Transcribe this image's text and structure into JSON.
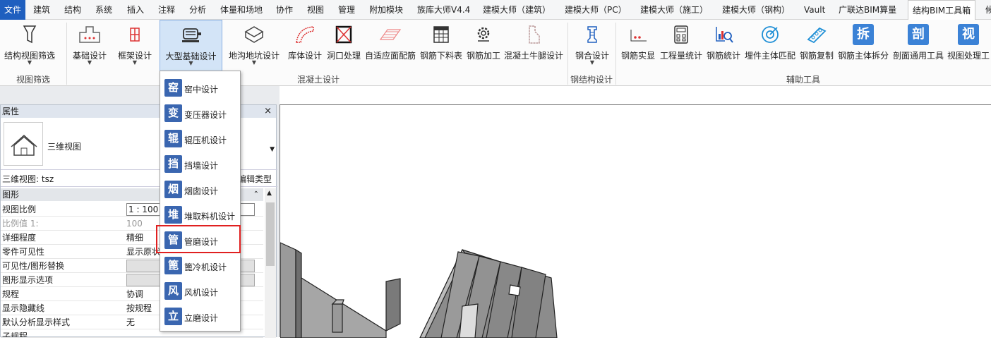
{
  "menu_tabs": [
    "文件",
    "建筑",
    "结构",
    "系统",
    "插入",
    "注释",
    "分析",
    "体量和场地",
    "协作",
    "视图",
    "管理",
    "附加模块",
    "族库大师V4.4",
    "建模大师（建筑）",
    "建模大师（PC）",
    "建模大师（施工）",
    "建模大师（钢构）",
    "Vault",
    "广联达BIM算量",
    "结构BIM工具箱",
    "候"
  ],
  "active_tab": "结构BIM工具箱",
  "ribbon": {
    "buttons": [
      "结构视图筛选",
      "基础设计",
      "框架设计",
      "大型基础设计",
      "地沟地坑设计",
      "库体设计",
      "洞口处理",
      "自适应面配筋",
      "钢筋下料表",
      "钢筋加工",
      "混凝土牛腿设计",
      "钢合设计",
      "钢筋实显",
      "工程量统计",
      "钢筋統计",
      "埋件主体匹配",
      "钢筋复制",
      "钢筋主体拆分",
      "剖面通用工具",
      "视图处理工"
    ],
    "glyph_buttons": {
      "split": "拆",
      "section": "剖",
      "view": "视"
    },
    "groups": [
      "视图筛选",
      "混凝土设计",
      "钢结构设计",
      "辅助工具"
    ]
  },
  "properties": {
    "title": "属性",
    "close": "×",
    "type_name": "三维视图",
    "view_label": "三维视图: tsz",
    "edit_type": "编辑类型",
    "group_header": "图形",
    "rows": [
      {
        "name": "视图比例",
        "value": "1 : 100"
      },
      {
        "name": "比例值 1:",
        "value": "100"
      },
      {
        "name": "详细程度",
        "value": "精细"
      },
      {
        "name": "零件可见性",
        "value": "显示原状"
      },
      {
        "name": "可见性/图形替换",
        "value": ""
      },
      {
        "name": "图形显示选项",
        "value": ""
      },
      {
        "name": "规程",
        "value": "协调"
      },
      {
        "name": "显示隐藏线",
        "value": "按规程"
      },
      {
        "name": "默认分析显示样式",
        "value": "无"
      },
      {
        "name": "子规程",
        "value": ""
      }
    ]
  },
  "dropdown": {
    "items": [
      {
        "glyph": "窑",
        "label": "窑中设计"
      },
      {
        "glyph": "变",
        "label": "变压器设计"
      },
      {
        "glyph": "辊",
        "label": "辊压机设计"
      },
      {
        "glyph": "挡",
        "label": "挡墙设计"
      },
      {
        "glyph": "烟",
        "label": "烟囱设计"
      },
      {
        "glyph": "堆",
        "label": "堆取料机设计"
      },
      {
        "glyph": "管",
        "label": "管磨设计"
      },
      {
        "glyph": "篦",
        "label": "篦冷机设计"
      },
      {
        "glyph": "风",
        "label": "风机设计"
      },
      {
        "glyph": "立",
        "label": "立磨设计"
      }
    ],
    "highlighted": "管磨设计"
  },
  "colors": {
    "accent": "#1f5fbf",
    "highlight": "#e02020",
    "icon_blue": "#3a66b0"
  }
}
